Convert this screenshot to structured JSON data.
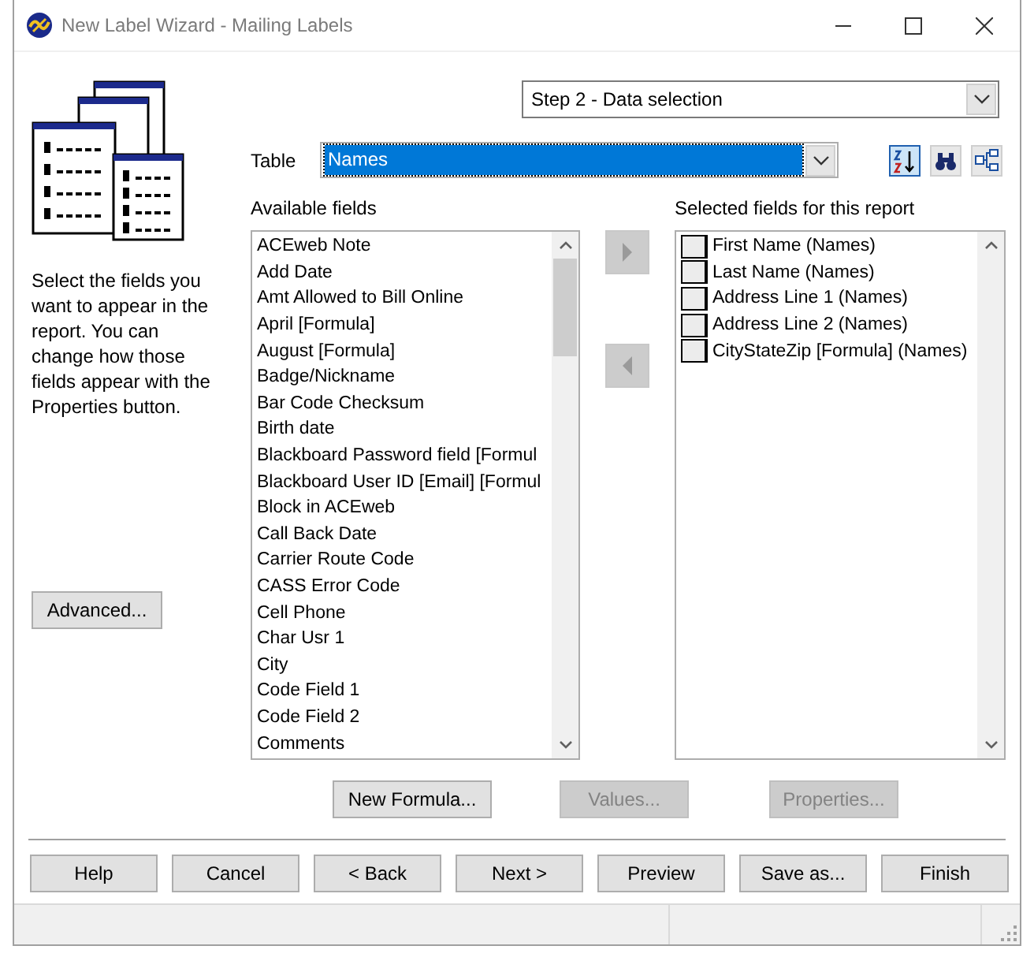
{
  "window": {
    "title": "New Label Wizard - Mailing Labels"
  },
  "step": {
    "value": "Step 2 - Data selection"
  },
  "table": {
    "label": "Table",
    "value": "Names"
  },
  "toolbar": [
    {
      "kind": "sort",
      "selected": true
    },
    {
      "kind": "find",
      "selected": false
    },
    {
      "kind": "relations",
      "selected": false
    }
  ],
  "description": "Select the fields you want to appear in the report. You can change how those fields appear with the Properties button.",
  "advanced_button": {
    "label": "Advanced..."
  },
  "available_fields": {
    "label": "Available fields",
    "items": [
      "ACEweb Note",
      "Add Date",
      "Amt Allowed to Bill Online",
      "April [Formula]",
      "August [Formula]",
      "Badge/Nickname",
      "Bar Code Checksum",
      "Birth date",
      "Blackboard Password field [Formul",
      "Blackboard User ID [Email] [Formul",
      "Block in ACEweb",
      "Call Back Date",
      "Carrier Route Code",
      "CASS Error Code",
      "Cell Phone",
      "Char Usr 1",
      "City",
      "Code Field 1",
      "Code Field 2",
      "Comments"
    ]
  },
  "move_buttons": [
    {
      "kind": "add",
      "disabled": true
    },
    {
      "kind": "remove",
      "disabled": true
    }
  ],
  "selected_fields": {
    "label": "Selected fields for this report",
    "items": [
      "First Name (Names)",
      "Last Name (Names)",
      "Address Line 1 (Names)",
      "Address Line 2 (Names)",
      "CityStateZip [Formula] (Names)"
    ]
  },
  "field_buttons": [
    {
      "label": "New Formula...",
      "disabled": false
    },
    {
      "label": "Values...",
      "disabled": true
    },
    {
      "label": "Properties...",
      "disabled": true
    }
  ],
  "nav_buttons": [
    {
      "label": "Help"
    },
    {
      "label": "Cancel"
    },
    {
      "label": "< Back"
    },
    {
      "label": "Next >"
    },
    {
      "label": "Preview"
    },
    {
      "label": "Save as..."
    },
    {
      "label": "Finish"
    }
  ]
}
